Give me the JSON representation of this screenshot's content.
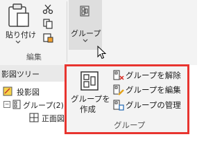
{
  "ribbon": {
    "paste_label": "貼り付け",
    "edit_group_label": "編集",
    "group_button_label": "グループ"
  },
  "panel": {
    "title": "影図ツリー",
    "tree": [
      {
        "label": "投影図"
      },
      {
        "label": "グループ(2)"
      },
      {
        "label": "正面図"
      }
    ]
  },
  "popup": {
    "create_label_line1": "グループを",
    "create_label_line2": "作成",
    "items": [
      {
        "label": "グループを解除"
      },
      {
        "label": "グループを編集"
      },
      {
        "label": "グループの管理"
      }
    ],
    "footer": "グループ"
  },
  "colors": {
    "highlight_border": "#e8342f"
  }
}
